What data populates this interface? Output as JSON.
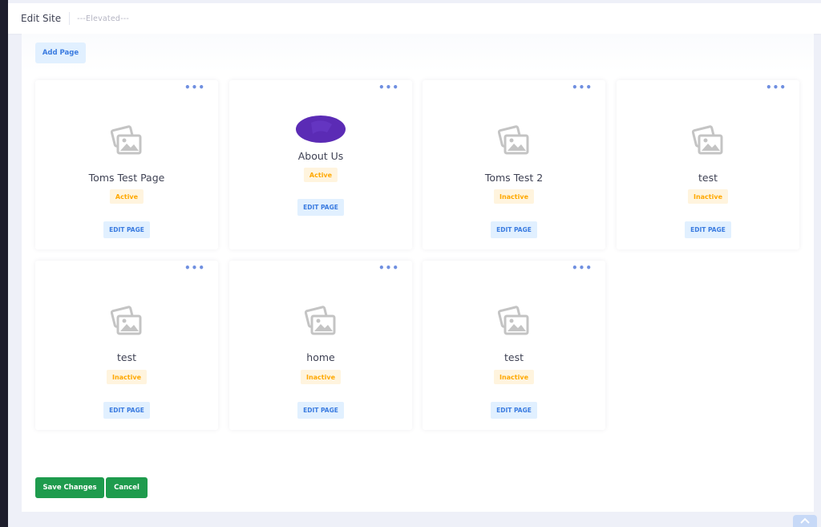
{
  "header": {
    "title": "Edit Site",
    "subtitle": "---Elevated---"
  },
  "toolbar": {
    "add_page_label": "Add Page"
  },
  "cards": [
    {
      "title": "Toms Test Page",
      "status": "Active",
      "edit_label": "EDIT PAGE",
      "more_label": "•••",
      "thumbnail": "image-placeholder-icon"
    },
    {
      "title": "About Us",
      "status": "Active",
      "edit_label": "EDIT PAGE",
      "more_label": "•••",
      "thumbnail": "purple-image"
    },
    {
      "title": "Toms Test 2",
      "status": "Inactive",
      "edit_label": "EDIT PAGE",
      "more_label": "•••",
      "thumbnail": "image-placeholder-icon"
    },
    {
      "title": "test",
      "status": "Inactive",
      "edit_label": "EDIT PAGE",
      "more_label": "•••",
      "thumbnail": "image-placeholder-icon"
    },
    {
      "title": "test",
      "status": "Inactive",
      "edit_label": "EDIT PAGE",
      "more_label": "•••",
      "thumbnail": "image-placeholder-icon"
    },
    {
      "title": "home",
      "status": "Inactive",
      "edit_label": "EDIT PAGE",
      "more_label": "•••",
      "thumbnail": "image-placeholder-icon"
    },
    {
      "title": "test",
      "status": "Inactive",
      "edit_label": "EDIT PAGE",
      "more_label": "•••",
      "thumbnail": "image-placeholder-icon"
    }
  ],
  "footer": {
    "save_label": "Save Changes",
    "cancel_label": "Cancel"
  },
  "colors": {
    "accent": "#3699ff",
    "accent_bg": "#e1f0ff",
    "status_bg": "#fff4de",
    "status_text": "#ffa800",
    "success": "#1e9b4d",
    "sidebar": "#1e1e2d",
    "page_bg": "#eef0f8",
    "avatar": "#5b2bb5"
  },
  "icons": {
    "placeholder": "image-placeholder-icon",
    "more": "more-dots-icon",
    "scroll_top": "arrow-up-icon"
  }
}
